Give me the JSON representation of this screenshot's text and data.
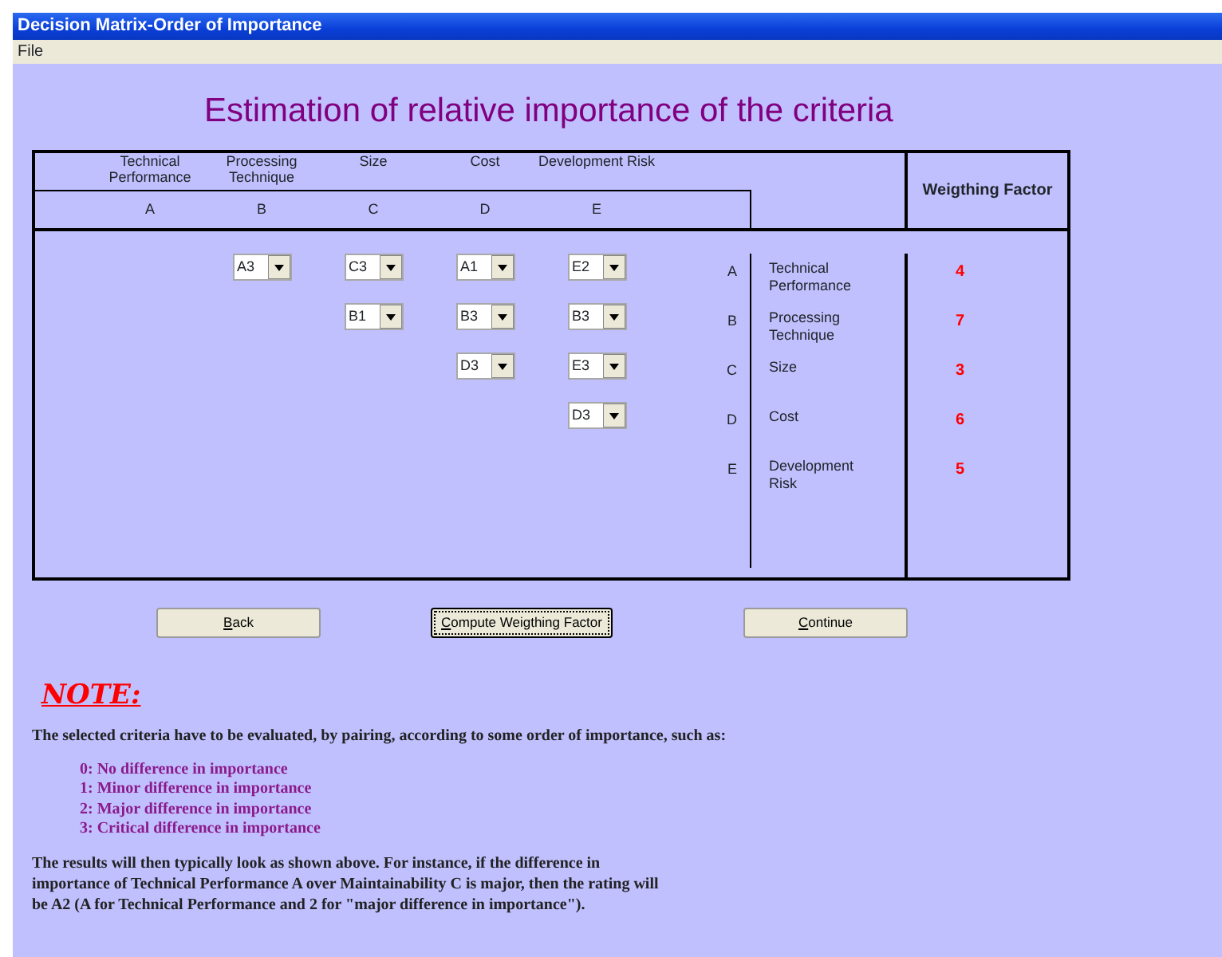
{
  "window": {
    "title": "Decision Matrix-Order of Importance"
  },
  "menu": [
    "File"
  ],
  "heading": "Estimation of relative importance of the criteria",
  "matrix": {
    "columns": [
      {
        "name": "Technical Performance",
        "letter": "A"
      },
      {
        "name": "Processing Technique",
        "letter": "B"
      },
      {
        "name": "Size",
        "letter": "C"
      },
      {
        "name": "Cost",
        "letter": "D"
      },
      {
        "name": "Development Risk",
        "letter": "E"
      }
    ],
    "weight_header": "Weigthing Factor",
    "rows": [
      {
        "letter": "A",
        "name": "Technical Performance",
        "weight": "4",
        "cells": [
          "",
          "A3",
          "C3",
          "A1",
          "E2"
        ]
      },
      {
        "letter": "B",
        "name": "Processing Technique",
        "weight": "7",
        "cells": [
          "",
          "",
          "B1",
          "B3",
          "B3"
        ]
      },
      {
        "letter": "C",
        "name": "Size",
        "weight": "3",
        "cells": [
          "",
          "",
          "",
          "D3",
          "E3"
        ]
      },
      {
        "letter": "D",
        "name": "Cost",
        "weight": "6",
        "cells": [
          "",
          "",
          "",
          "",
          "D3"
        ]
      },
      {
        "letter": "E",
        "name": "Development Risk",
        "weight": "5",
        "cells": [
          "",
          "",
          "",
          "",
          ""
        ]
      }
    ]
  },
  "buttons": [
    {
      "label": "Back",
      "focused": false
    },
    {
      "label": "Compute Weigthing Factor",
      "focused": true
    },
    {
      "label": "Continue",
      "focused": false
    }
  ],
  "note": {
    "title": "NOTE:",
    "intro": "The selected criteria have to be evaluated, by pairing, according to some order of importance, such as:",
    "levels": [
      "0: No difference in importance",
      "1: Minor difference in importance",
      "2: Major difference in importance",
      "3: Critical difference in importance"
    ],
    "text": "The results will then typically look as shown above. For instance, if the difference in importance of Technical Performance A over Maintainability C is major, then the rating will be A2 (A for Technical Performance and 2 for \"major difference in importance\")."
  }
}
